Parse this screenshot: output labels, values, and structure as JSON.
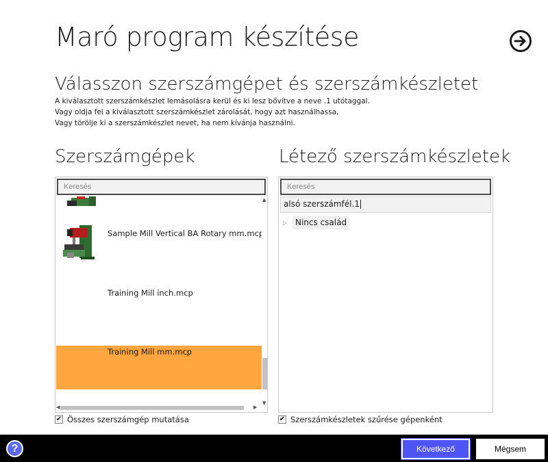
{
  "header": {
    "title": "Maró program készítése",
    "next_icon": "arrow-right-circle-icon"
  },
  "intro": {
    "subtitle": "Válasszon szerszámgépet és szerszámkészletet",
    "lines": [
      "A kiválasztott szerszámkészlet lemásolásra kerül és ki lesz bővítve a neve .1 utótaggal.",
      "Vagy oldja fel a kiválasztott szerszámkészlet zárolását, hogy azt használhassa,",
      "Vagy törölje ki a szerszámkészlet nevet, ha nem kívánja használni."
    ]
  },
  "machines": {
    "title": "Szerszámgépek",
    "search_placeholder": "Keresés",
    "items": [
      {
        "name": "",
        "icon": "mill-machine-icon"
      },
      {
        "name": "Sample Mill Vertical BA Rotary mm.mcp",
        "icon": "mill-machine-icon"
      },
      {
        "name": "Training Mill inch.mcp",
        "icon": ""
      },
      {
        "name": "Training Mill mm.mcp",
        "icon": "",
        "selected": true
      }
    ],
    "show_all_label": "Összes szerszámgép mutatása",
    "show_all_checked": true
  },
  "toolsets": {
    "title": "Létező szerszámkészletek",
    "search_placeholder": "Keresés",
    "name_value": "alsó szerszámfél.1",
    "tree_node": "Nincs család",
    "filter_label": "Szerszámkészletek szűrése gépenként",
    "filter_checked": true
  },
  "footer": {
    "help_label": "?",
    "next_label": "Következő",
    "cancel_label": "Mégsem"
  },
  "colors": {
    "selection": "#ffa641",
    "primary_button": "#4f55f5",
    "help": "#5c68f2"
  }
}
